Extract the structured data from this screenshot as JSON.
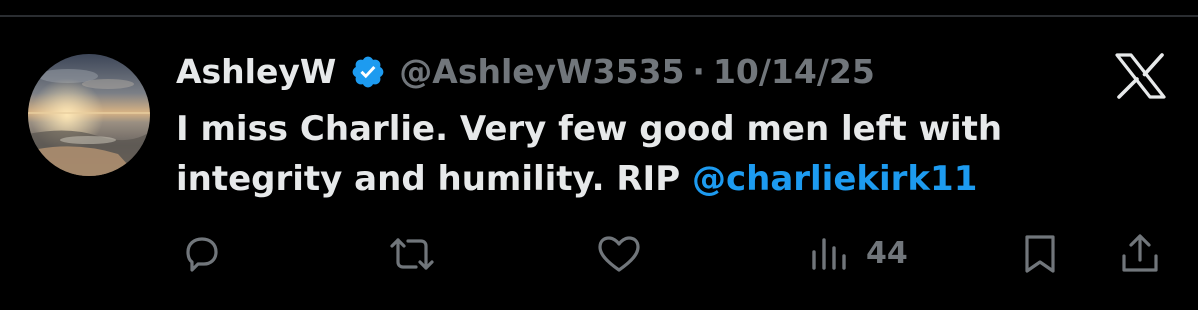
{
  "tweet": {
    "display_name": "AshleyW",
    "verified": true,
    "handle": "@AshleyW3535",
    "separator": "·",
    "date": "10/14/25",
    "text_main": "I miss Charlie. Very few good men left with integrity and humility. RIP ",
    "mention": "@charliekirk11",
    "avatar": "beach-sunset-photo",
    "platform_logo": "x-logo-icon"
  },
  "actions": {
    "reply_icon": "reply-icon",
    "repost_icon": "repost-icon",
    "like_icon": "like-icon",
    "views_icon": "views-icon",
    "views_count": "44",
    "bookmark_icon": "bookmark-icon",
    "share_icon": "share-icon"
  },
  "colors": {
    "background": "#000000",
    "text": "#e7e9ea",
    "secondary": "#71767b",
    "accent": "#1d9bf0"
  }
}
